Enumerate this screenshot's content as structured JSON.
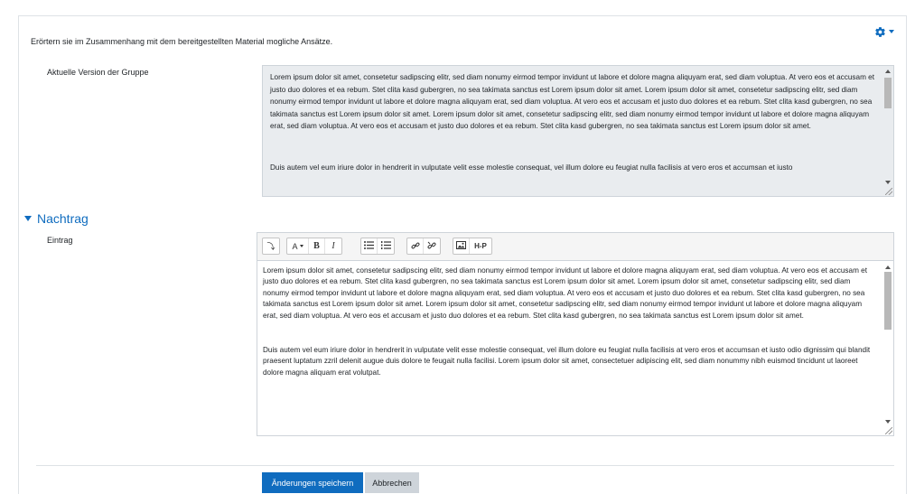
{
  "intro_text": "Erörtern sie im Zusammenhang mit dem bereitgestellten Material mogliche Ansätze.",
  "settings": {
    "icon": "gear-icon"
  },
  "current_version": {
    "label": "Aktuelle Version der Gruppe",
    "paragraphs": [
      "Lorem ipsum dolor sit amet, consetetur sadipscing elitr, sed diam nonumy eirmod tempor invidunt ut labore et dolore magna aliquyam erat, sed diam voluptua. At vero eos et accusam et justo duo dolores et ea rebum. Stet clita kasd gubergren, no sea takimata sanctus est Lorem ipsum dolor sit amet. Lorem ipsum dolor sit amet, consetetur sadipscing elitr, sed diam nonumy eirmod tempor invidunt ut labore et dolore magna aliquyam erat, sed diam voluptua. At vero eos et accusam et justo duo dolores et ea rebum. Stet clita kasd gubergren, no sea takimata sanctus est Lorem ipsum dolor sit amet. Lorem ipsum dolor sit amet, consetetur sadipscing elitr, sed diam nonumy eirmod tempor invidunt ut labore et dolore magna aliquyam erat, sed diam voluptua. At vero eos et accusam et justo duo dolores et ea rebum. Stet clita kasd gubergren, no sea takimata sanctus est Lorem ipsum dolor sit amet.",
      "Duis autem vel eum iriure dolor in hendrerit in vulputate velit esse molestie consequat, vel illum dolore eu feugiat nulla facilisis at vero eros et accumsan et iusto"
    ]
  },
  "addendum": {
    "section_title": "Nachtrag",
    "label": "Eintrag",
    "toolbar": {
      "buttons": [
        {
          "name": "toolbar-toggle-button",
          "text": "⤵"
        },
        {
          "name": "font-style-button",
          "text": "A"
        },
        {
          "name": "bold-button",
          "text": "B"
        },
        {
          "name": "italic-button",
          "text": "I"
        },
        {
          "name": "h5p-button",
          "text": "H-P"
        }
      ]
    },
    "paragraphs": [
      "Lorem ipsum dolor sit amet, consetetur sadipscing elitr, sed diam nonumy eirmod tempor invidunt ut labore et dolore magna aliquyam erat, sed diam voluptua. At vero eos et accusam et justo duo dolores et ea rebum. Stet clita kasd gubergren, no sea takimata sanctus est Lorem ipsum dolor sit amet. Lorem ipsum dolor sit amet, consetetur sadipscing elitr, sed diam nonumy eirmod tempor invidunt ut labore et dolore magna aliquyam erat, sed diam voluptua. At vero eos et accusam et justo duo dolores et ea rebum. Stet clita kasd gubergren, no sea takimata sanctus est Lorem ipsum dolor sit amet. Lorem ipsum dolor sit amet, consetetur sadipscing elitr, sed diam nonumy eirmod tempor invidunt ut labore et dolore magna aliquyam erat, sed diam voluptua. At vero eos et accusam et justo duo dolores et ea rebum. Stet clita kasd gubergren, no sea takimata sanctus est Lorem ipsum dolor sit amet.",
      "Duis autem vel eum iriure dolor in hendrerit in vulputate velit esse molestie consequat, vel illum dolore eu feugiat nulla facilisis at vero eros et accumsan et iusto odio dignissim qui blandit praesent luptatum zzril delenit augue duis dolore te feugait nulla facilisi. Lorem ipsum dolor sit amet, consectetuer adipiscing elit, sed diam nonummy nibh euismod tincidunt ut laoreet dolore magna aliquam erat volutpat."
    ]
  },
  "actions": {
    "save_label": "Änderungen speichern",
    "cancel_label": "Abbrechen"
  }
}
